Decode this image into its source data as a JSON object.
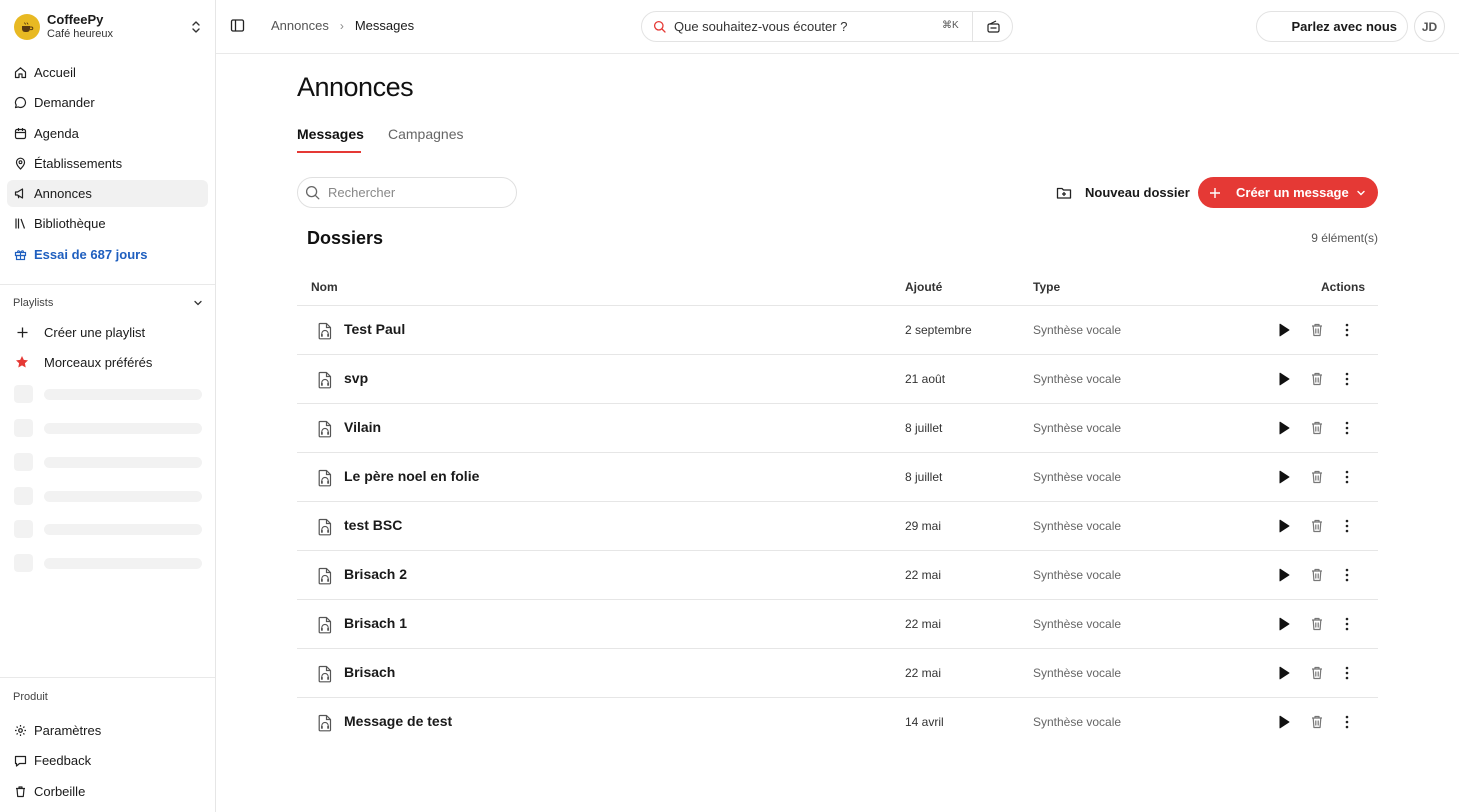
{
  "brand": {
    "name": "CoffeePy",
    "subtitle": "Café heureux"
  },
  "nav": [
    {
      "label": "Accueil",
      "icon": "home-icon",
      "active": false
    },
    {
      "label": "Demander",
      "icon": "chat-icon",
      "active": false
    },
    {
      "label": "Agenda",
      "icon": "calendar-icon",
      "active": false
    },
    {
      "label": "Établissements",
      "icon": "map-pin-icon",
      "active": false
    },
    {
      "label": "Annonces",
      "icon": "megaphone-icon",
      "active": true
    },
    {
      "label": "Bibliothèque",
      "icon": "library-icon",
      "active": false
    },
    {
      "label": "Essai de 687 jours",
      "icon": "gift-icon",
      "active": false
    }
  ],
  "playlists": {
    "header": "Playlists",
    "create": "Créer une playlist",
    "favorites": "Morceaux préférés"
  },
  "product": {
    "label": "Produit",
    "items": [
      {
        "label": "Paramètres",
        "icon": "settings-icon"
      },
      {
        "label": "Feedback",
        "icon": "feedback-icon"
      },
      {
        "label": "Corbeille",
        "icon": "trash-icon"
      }
    ]
  },
  "topbar": {
    "breadcrumb": [
      "Annonces",
      "Messages"
    ],
    "search_placeholder": "Que souhaitez-vous écouter ?",
    "search_shortcut": "⌘K",
    "talk_button": "Parlez avec nous",
    "avatar_initials": "JD"
  },
  "page": {
    "title": "Annonces",
    "tabs": [
      "Messages",
      "Campagnes"
    ],
    "active_tab": "Messages",
    "search_placeholder": "Rechercher",
    "new_folder": "Nouveau dossier",
    "create_message": "Créer un message",
    "section_title": "Dossiers",
    "count": "9 élément(s)"
  },
  "table": {
    "columns": [
      "Nom",
      "Ajouté",
      "Type",
      "Actions"
    ],
    "rows": [
      {
        "name": "Test Paul",
        "added": "2 septembre",
        "type": "Synthèse vocale"
      },
      {
        "name": "svp",
        "added": "21 août",
        "type": "Synthèse vocale"
      },
      {
        "name": "Vilain",
        "added": "8 juillet",
        "type": "Synthèse vocale"
      },
      {
        "name": "Le père noel en folie",
        "added": "8 juillet",
        "type": "Synthèse vocale"
      },
      {
        "name": "test BSC",
        "added": "29 mai",
        "type": "Synthèse vocale"
      },
      {
        "name": "Brisach 2",
        "added": "22 mai",
        "type": "Synthèse vocale"
      },
      {
        "name": "Brisach 1",
        "added": "22 mai",
        "type": "Synthèse vocale"
      },
      {
        "name": "Brisach",
        "added": "22 mai",
        "type": "Synthèse vocale"
      },
      {
        "name": "Message de test",
        "added": "14 avril",
        "type": "Synthèse vocale"
      }
    ]
  },
  "colors": {
    "accent": "#e53935",
    "link": "#1f5fbf",
    "brand_logo": "#e8b923",
    "favorite_star": "#e53935"
  }
}
